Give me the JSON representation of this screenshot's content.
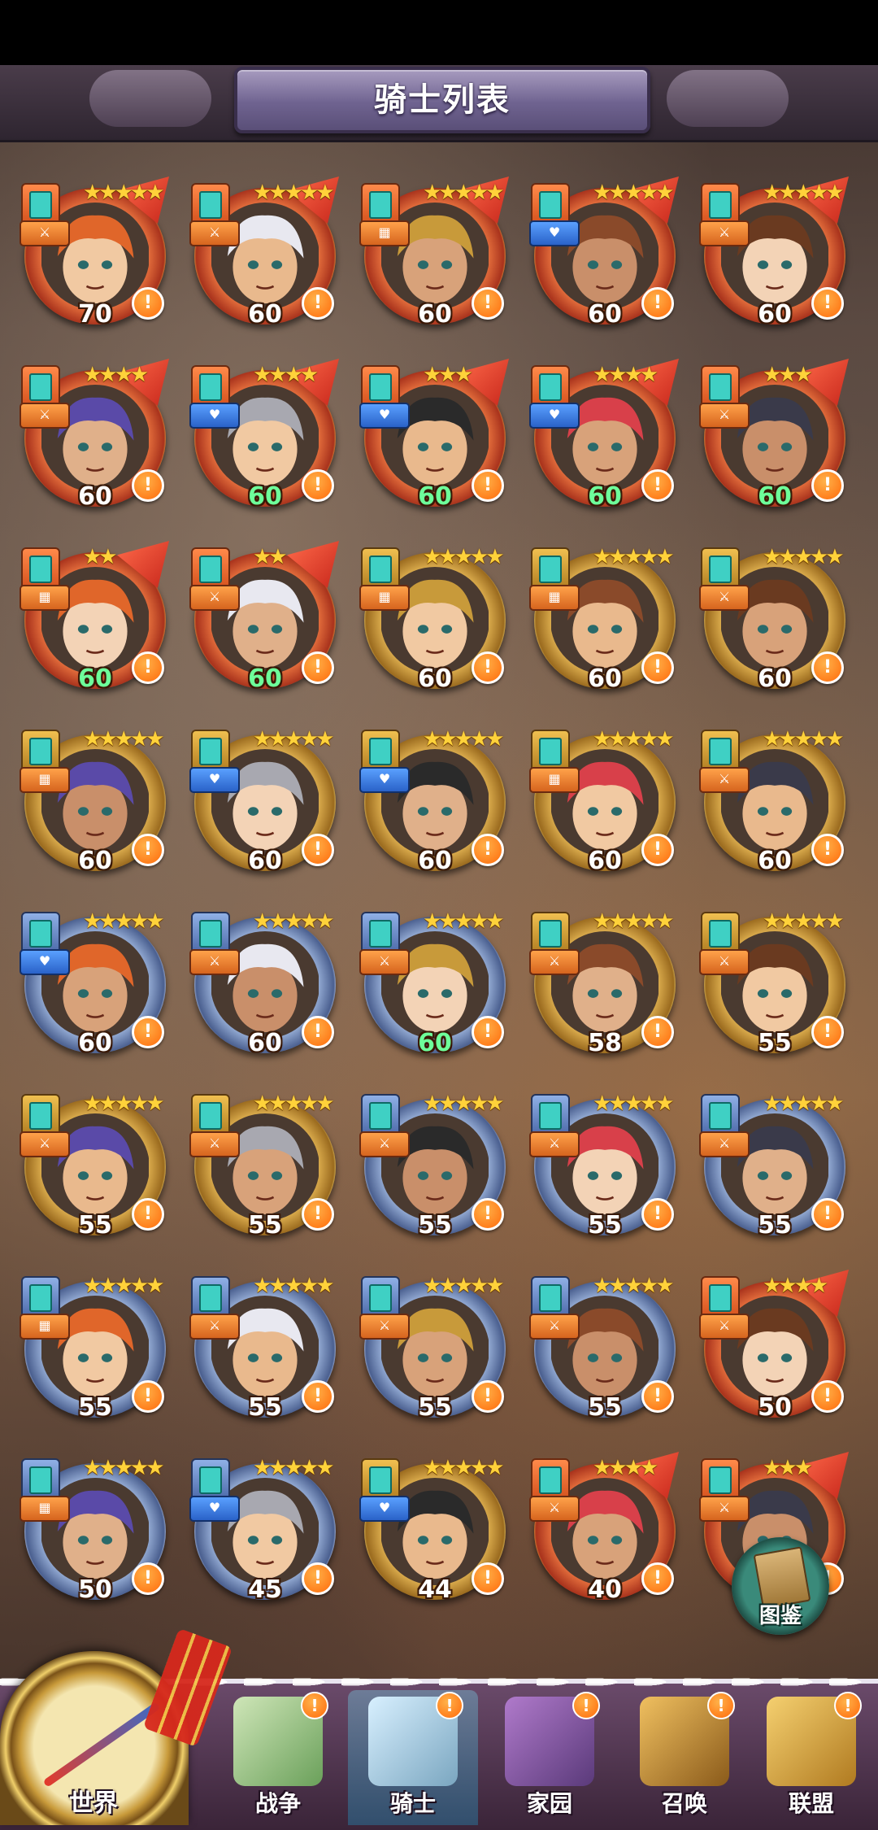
{
  "header": {
    "title": "骑士列表"
  },
  "knights": [
    {
      "level": "70",
      "stars": 5,
      "tier": "red",
      "level_color": "white",
      "role": "sword"
    },
    {
      "level": "60",
      "stars": 5,
      "tier": "red",
      "level_color": "white",
      "role": "sword"
    },
    {
      "level": "60",
      "stars": 5,
      "tier": "red",
      "level_color": "white",
      "role": "wall"
    },
    {
      "level": "60",
      "stars": 5,
      "tier": "red",
      "level_color": "white",
      "role": "heart"
    },
    {
      "level": "60",
      "stars": 5,
      "tier": "red",
      "level_color": "white",
      "role": "sword"
    },
    {
      "level": "60",
      "stars": 4,
      "tier": "red",
      "level_color": "white",
      "role": "sword"
    },
    {
      "level": "60",
      "stars": 4,
      "tier": "red",
      "level_color": "green",
      "role": "heart"
    },
    {
      "level": "60",
      "stars": 3,
      "tier": "red",
      "level_color": "green",
      "role": "heart"
    },
    {
      "level": "60",
      "stars": 4,
      "tier": "red",
      "level_color": "green",
      "role": "heart"
    },
    {
      "level": "60",
      "stars": 3,
      "tier": "red",
      "level_color": "green",
      "role": "sword"
    },
    {
      "level": "60",
      "stars": 2,
      "tier": "red",
      "level_color": "green",
      "role": "wall"
    },
    {
      "level": "60",
      "stars": 2,
      "tier": "red",
      "level_color": "green",
      "role": "sword"
    },
    {
      "level": "60",
      "stars": 5,
      "tier": "gold",
      "level_color": "white",
      "role": "wall"
    },
    {
      "level": "60",
      "stars": 5,
      "tier": "gold",
      "level_color": "white",
      "role": "wall"
    },
    {
      "level": "60",
      "stars": 5,
      "tier": "gold",
      "level_color": "white",
      "role": "sword"
    },
    {
      "level": "60",
      "stars": 5,
      "tier": "gold",
      "level_color": "white",
      "role": "wall"
    },
    {
      "level": "60",
      "stars": 5,
      "tier": "gold",
      "level_color": "white",
      "role": "heart"
    },
    {
      "level": "60",
      "stars": 5,
      "tier": "gold",
      "level_color": "white",
      "role": "heart"
    },
    {
      "level": "60",
      "stars": 5,
      "tier": "gold",
      "level_color": "white",
      "role": "wall"
    },
    {
      "level": "60",
      "stars": 5,
      "tier": "gold",
      "level_color": "white",
      "role": "sword"
    },
    {
      "level": "60",
      "stars": 5,
      "tier": "blue",
      "level_color": "white",
      "role": "heart"
    },
    {
      "level": "60",
      "stars": 5,
      "tier": "blue",
      "level_color": "white",
      "role": "sword"
    },
    {
      "level": "60",
      "stars": 5,
      "tier": "blue",
      "level_color": "green",
      "role": "sword"
    },
    {
      "level": "58",
      "stars": 5,
      "tier": "gold",
      "level_color": "white",
      "role": "sword"
    },
    {
      "level": "55",
      "stars": 5,
      "tier": "gold",
      "level_color": "white",
      "role": "sword"
    },
    {
      "level": "55",
      "stars": 5,
      "tier": "gold",
      "level_color": "white",
      "role": "sword"
    },
    {
      "level": "55",
      "stars": 5,
      "tier": "gold",
      "level_color": "white",
      "role": "sword"
    },
    {
      "level": "55",
      "stars": 5,
      "tier": "blue",
      "level_color": "white",
      "role": "sword"
    },
    {
      "level": "55",
      "stars": 5,
      "tier": "blue",
      "level_color": "white",
      "role": "sword"
    },
    {
      "level": "55",
      "stars": 5,
      "tier": "blue",
      "level_color": "white",
      "role": "sword"
    },
    {
      "level": "55",
      "stars": 5,
      "tier": "blue",
      "level_color": "white",
      "role": "wall"
    },
    {
      "level": "55",
      "stars": 5,
      "tier": "blue",
      "level_color": "white",
      "role": "sword"
    },
    {
      "level": "55",
      "stars": 5,
      "tier": "blue",
      "level_color": "white",
      "role": "sword"
    },
    {
      "level": "55",
      "stars": 5,
      "tier": "blue",
      "level_color": "white",
      "role": "sword"
    },
    {
      "level": "50",
      "stars": 4,
      "tier": "red",
      "level_color": "white",
      "role": "sword"
    },
    {
      "level": "50",
      "stars": 5,
      "tier": "blue",
      "level_color": "white",
      "role": "wall"
    },
    {
      "level": "45",
      "stars": 5,
      "tier": "blue",
      "level_color": "white",
      "role": "heart"
    },
    {
      "level": "44",
      "stars": 5,
      "tier": "gold",
      "level_color": "white",
      "role": "heart"
    },
    {
      "level": "40",
      "stars": 4,
      "tier": "red",
      "level_color": "white",
      "role": "sword"
    },
    {
      "level": "",
      "stars": 3,
      "tier": "red",
      "level_color": "white",
      "role": "sword"
    }
  ],
  "alert_symbol": "!",
  "codex_button": {
    "label": "图鉴",
    "icon": "book-icon"
  },
  "bottom_nav": [
    {
      "label": "世界",
      "icon": "compass-icon",
      "badge": ""
    },
    {
      "label": "战争",
      "icon": "map-icon",
      "badge": "!"
    },
    {
      "label": "骑士",
      "icon": "knight-icon",
      "badge": "!",
      "active": true
    },
    {
      "label": "家园",
      "icon": "house-icon",
      "badge": "!"
    },
    {
      "label": "召唤",
      "icon": "train-icon",
      "badge": "!"
    },
    {
      "label": "联盟",
      "icon": "guild-icon",
      "badge": "!"
    }
  ],
  "colors": {
    "tier_red": "#e06a3a",
    "tier_gold": "#d7a84a",
    "tier_blue": "#8fa6cf",
    "level_green": "#6dff9a",
    "alert_orange": "#ff6a0a"
  }
}
